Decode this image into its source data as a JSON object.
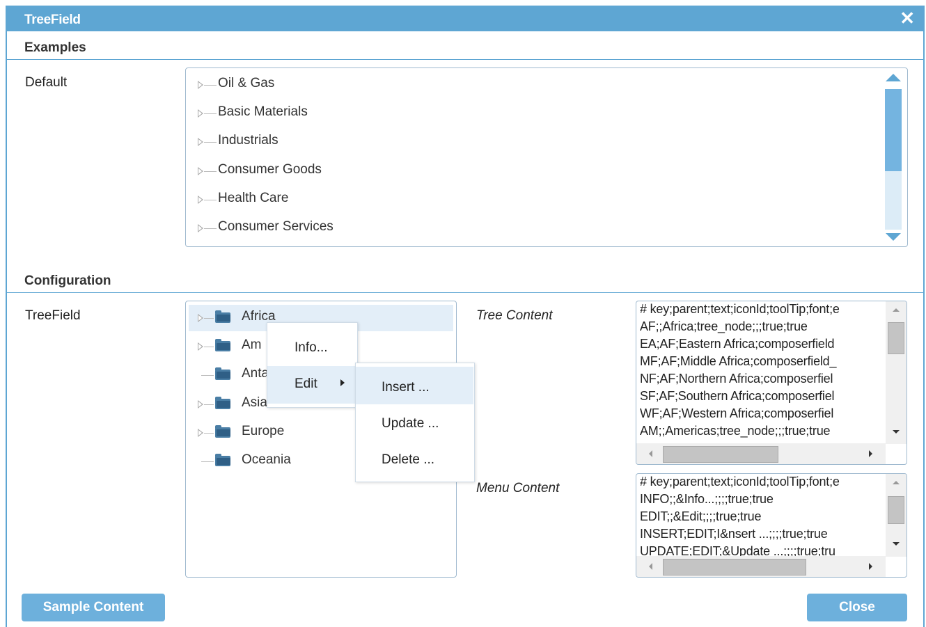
{
  "window": {
    "title": "TreeField",
    "close_glyph": "✕"
  },
  "sections": {
    "examples": "Examples",
    "configuration": "Configuration"
  },
  "examples": {
    "default_label": "Default",
    "tree_items": [
      "Oil & Gas",
      "Basic Materials",
      "Industrials",
      "Consumer Goods",
      "Health Care",
      "Consumer Services"
    ]
  },
  "config": {
    "treefield_label": "TreeField",
    "tree_items": [
      "Africa",
      "Am",
      "Anta",
      "Asia",
      "Europe",
      "Oceania"
    ],
    "tree_content_label": "Tree Content",
    "menu_content_label": "Menu Content",
    "tree_content_lines": [
      "# key;parent;text;iconId;toolTip;font;e",
      "AF;;Africa;tree_node;;;true;true",
      "EA;AF;Eastern Africa;composerfield",
      "MF;AF;Middle Africa;composerfield_",
      "NF;AF;Northern Africa;composerfiel",
      "SF;AF;Southern Africa;composerfiel",
      "WF;AF;Western Africa;composerfiel",
      "AM;;Americas;tree_node;;;true;true"
    ],
    "menu_content_lines": [
      "# key;parent;text;iconId;toolTip;font;e",
      "INFO;;&Info...;;;;true;true",
      "EDIT;;&Edit;;;;true;true",
      "INSERT;EDIT;I&nsert ...;;;;true;true",
      "UPDATE;EDIT;&Update ...;;;;true;tru"
    ]
  },
  "context_menu": {
    "info": "Info...",
    "edit": "Edit"
  },
  "submenu": {
    "insert": "Insert ...",
    "update": "Update ...",
    "delete": "Delete ..."
  },
  "buttons": {
    "sample": "Sample Content",
    "close": "Close"
  },
  "colors": {
    "accent": "#5ea6d3",
    "button": "#6db0dc",
    "selection": "#e3eef8"
  }
}
